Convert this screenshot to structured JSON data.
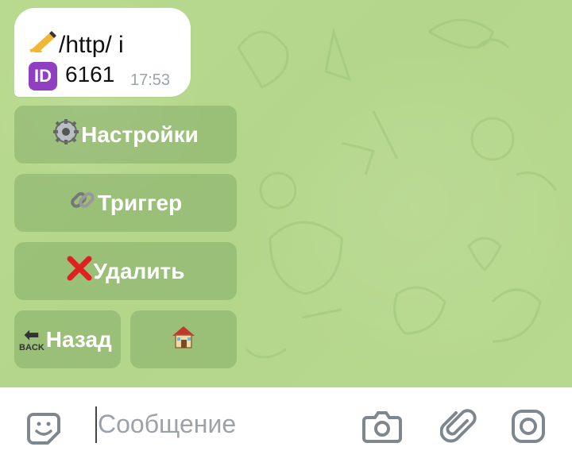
{
  "message": {
    "line1_text": "/http/ i",
    "line1_icon": "writing-hand-icon",
    "id_badge": "ID",
    "id_value": "6161",
    "time": "17:53"
  },
  "keyboard": {
    "settings": {
      "icon": "gear-icon",
      "label": "Настройки"
    },
    "trigger": {
      "icon": "link-icon",
      "label": "Триггер"
    },
    "delete": {
      "icon": "cross-mark-icon",
      "label": "Удалить"
    },
    "back": {
      "icon": "back-arrow-icon",
      "icon_text": "BACK",
      "label": "Назад"
    },
    "home": {
      "icon": "house-icon",
      "label": ""
    }
  },
  "composer": {
    "placeholder": "Сообщение",
    "icons": [
      "sticker-icon",
      "camera-icon",
      "attach-icon",
      "instagram-icon"
    ]
  },
  "colors": {
    "chat_bg": "#b7d990",
    "button_bg": "#78a05f",
    "bubble_bg": "#ffffff",
    "id_badge": "#8f3fbf",
    "placeholder": "#9ba2a8"
  }
}
